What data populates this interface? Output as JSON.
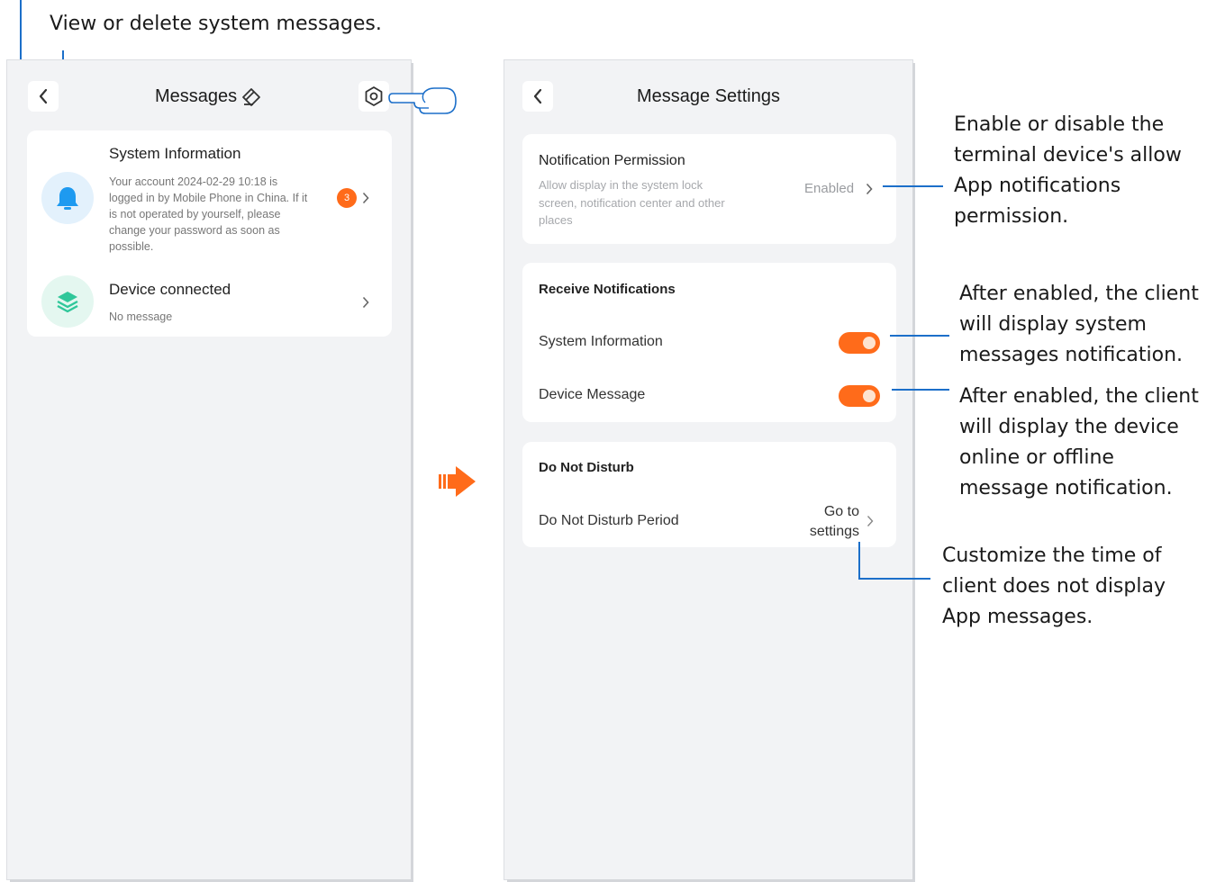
{
  "annotations": {
    "top": "View or delete system messages.",
    "notification_permission": [
      "Enable or disable the",
      "terminal device's allow",
      "App notifications",
      "permission."
    ],
    "system_information": [
      "After enabled, the client",
      "will display system",
      "messages notification."
    ],
    "device_message": [
      "After enabled, the client",
      "will display the device",
      "online or offline",
      "message notification."
    ],
    "do_not_disturb": [
      "Customize the time of",
      "client does not display",
      "App messages."
    ]
  },
  "messages_screen": {
    "title": "Messages",
    "items": [
      {
        "title": "System Information",
        "body": [
          "Your account 2024-02-29 10:18 is",
          "logged in by Mobile Phone in China. If it",
          "is not operated by yourself, please",
          "change your password as soon as",
          "possible."
        ],
        "badge": "3",
        "icon": "bell-icon"
      },
      {
        "title": "Device connected",
        "body": [
          "No message"
        ],
        "icon": "layers-icon"
      }
    ]
  },
  "settings_screen": {
    "title": "Message Settings",
    "notification_permission": {
      "title": "Notification Permission",
      "description": [
        "Allow display in the system lock",
        "screen, notification center and other",
        "places"
      ],
      "value": "Enabled"
    },
    "receive_notifications": {
      "heading": "Receive Notifications",
      "items": [
        {
          "label": "System Information",
          "enabled": true
        },
        {
          "label": "Device Message",
          "enabled": true
        }
      ]
    },
    "do_not_disturb": {
      "heading": "Do Not Disturb",
      "item_label": "Do Not Disturb Period",
      "action": [
        "Go to",
        "settings"
      ]
    }
  },
  "colors": {
    "accent": "#ff6b1a",
    "annotation_line": "#1c6fc9",
    "background": "#f2f3f5",
    "bell": "#1e9af0",
    "layers": "#2fc79a"
  }
}
